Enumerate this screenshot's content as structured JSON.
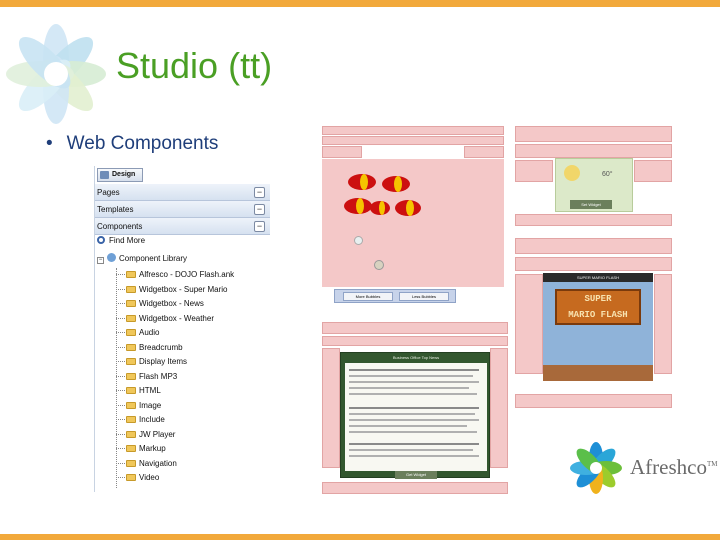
{
  "slide": {
    "title": "Studio (tt)",
    "bullet": "Web Components"
  },
  "tree_panel": {
    "design_button": "Design",
    "sections": [
      {
        "label": "Pages"
      },
      {
        "label": "Templates"
      },
      {
        "label": "Components"
      }
    ],
    "find_more": "Find More",
    "library": "Component Library",
    "items": [
      "Alfresco - DOJO Flash.ank",
      "Widgetbox - Super Mario",
      "Widgetbox - News",
      "Widgetbox - Weather",
      "Audio",
      "Breadcrumb",
      "Display Items",
      "Flash MP3",
      "HTML",
      "Image",
      "Include",
      "JW Player",
      "Markup",
      "Navigation",
      "Video"
    ]
  },
  "thumbnails": {
    "bubbles": {
      "buttons": [
        "More Bubbles",
        "Less Bubbles"
      ]
    },
    "weather": {
      "temp": "60°",
      "label": "Set Widget"
    },
    "mario": {
      "banner": "SUPER MARIO FLASH",
      "line1": "SUPER",
      "line2": "MARIO FLASH"
    },
    "news": {
      "header": "Business Office Top News",
      "button": "Get Widget"
    }
  },
  "brand": {
    "name": "Afreshco",
    "tm": "TM"
  },
  "colors": {
    "title": "#4a9f24",
    "bullet": "#1f3e7a",
    "rule": "#f2a93b"
  }
}
